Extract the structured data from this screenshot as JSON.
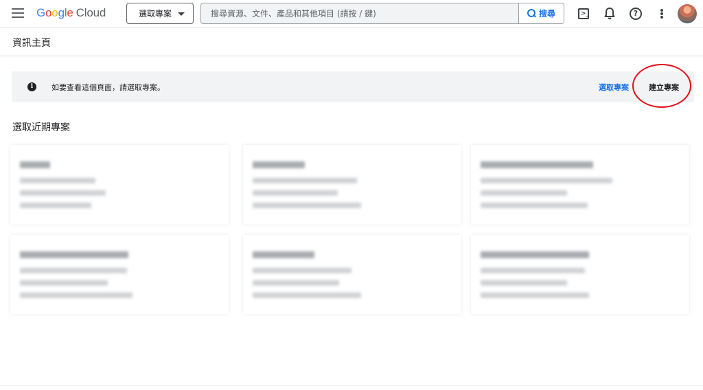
{
  "topbar": {
    "logo_google": [
      "G",
      "o",
      "o",
      "g",
      "l",
      "e"
    ],
    "logo_cloud": "Cloud",
    "project_select_label": "選取專案",
    "search_placeholder": "搜尋資源、文件、產品和其他項目 (請按 / 鍵)",
    "search_button_label": "搜尋",
    "icons": [
      "menu-icon",
      "terminal-icon",
      "bell-icon",
      "help-icon",
      "more-vert-icon",
      "avatar"
    ]
  },
  "page": {
    "title": "資訊主頁"
  },
  "banner": {
    "icon": "info-icon",
    "message": "如要查看這個頁面，請選取專案。",
    "select_link": "選取專案",
    "create_link": "建立專案"
  },
  "recent": {
    "title": "選取近期專案",
    "cards": [
      {
        "blurred": true
      },
      {
        "blurred": true
      },
      {
        "blurred": true
      },
      {
        "blurred": true
      },
      {
        "blurred": true
      },
      {
        "blurred": true
      }
    ]
  },
  "colors": {
    "accent": "#1a73e8",
    "banner_bg": "#f1f3f4",
    "highlight_circle": "#e0101a"
  }
}
